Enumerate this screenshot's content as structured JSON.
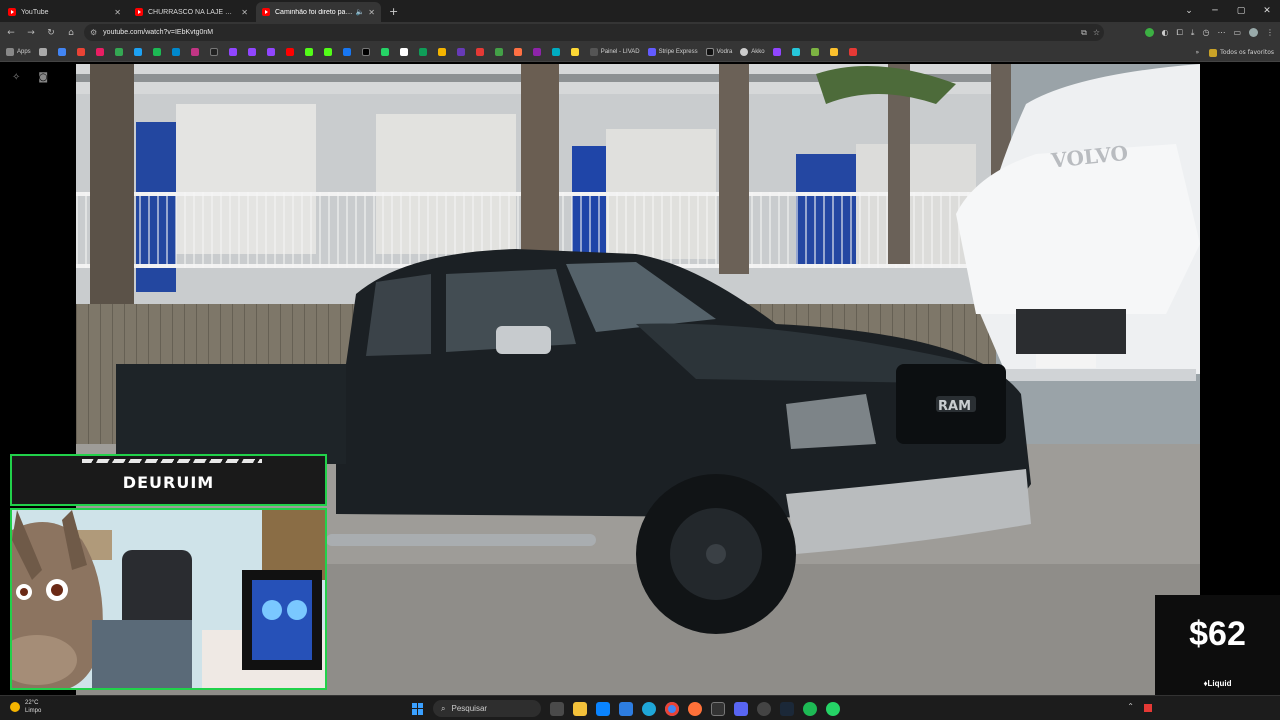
{
  "browser": {
    "tabs": [
      {
        "title": "YouTube",
        "active": false
      },
      {
        "title": "CHURRASCO NA LAJE QUASE DEU",
        "active": false
      },
      {
        "title": "Caminhão foi direto para o",
        "active": true
      }
    ],
    "url": "youtube.com/watch?v=IEbKvtg0nM",
    "bookmarks_left_label": "Apps",
    "bookmarks": [
      "Painel - LIVAD",
      "Stripe Express",
      "Vodra",
      "Akko"
    ],
    "bookmarks_right_label": "Todos os favoritos"
  },
  "stream": {
    "streamer_name": "DEURUIM",
    "donation_amount": "$62",
    "donation_brand": "Liquid",
    "overlay_color": "#21d14a"
  },
  "video": {
    "truck_badge": "RAM",
    "semi_badge": "VOLVO"
  },
  "taskbar": {
    "weather_temp": "22°C",
    "weather_desc": "Limpo",
    "search_placeholder": "Pesquisar"
  }
}
